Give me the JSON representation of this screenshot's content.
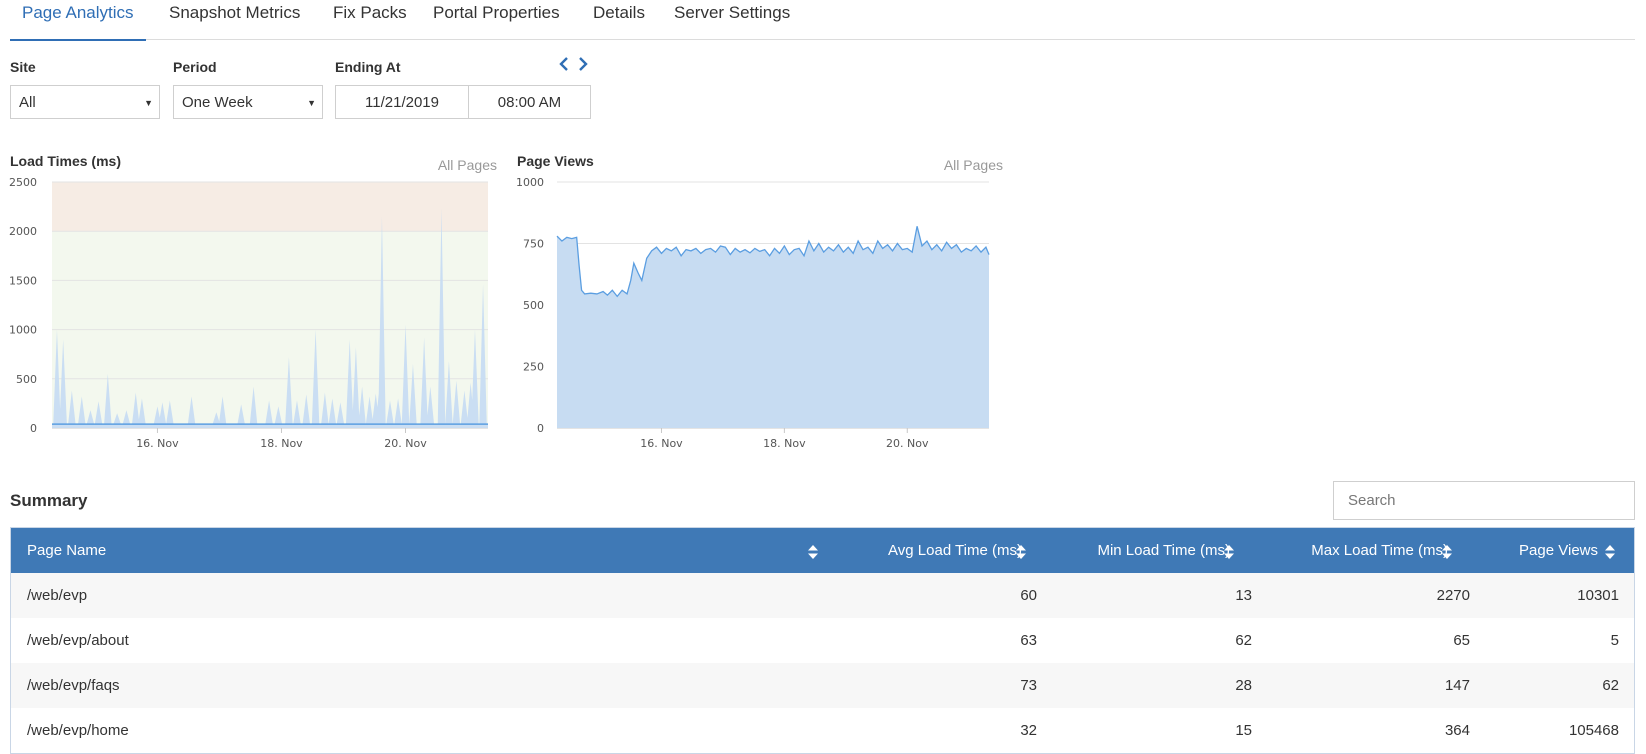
{
  "tabs": [
    {
      "label": "Page Analytics",
      "active": true
    },
    {
      "label": "Snapshot Metrics"
    },
    {
      "label": "Fix Packs"
    },
    {
      "label": "Portal Properties"
    },
    {
      "label": "Details"
    },
    {
      "label": "Server Settings"
    }
  ],
  "filters": {
    "site": {
      "label": "Site",
      "value": "All"
    },
    "period": {
      "label": "Period",
      "value": "One Week"
    },
    "ending": {
      "label": "Ending At",
      "date": "11/21/2019",
      "time": "08:00 AM"
    }
  },
  "colors": {
    "accent": "#2f6eb5",
    "table_header": "#3f79b6",
    "series_line": "#5b9ee1",
    "series_fill": "#c7dcf2",
    "band_warning": "#f6ece4",
    "band_ok": "#f3f8ee"
  },
  "icons": {
    "prev": "chevron-left-icon",
    "next": "chevron-right-icon",
    "sort": "sort-icon",
    "caret": "caret-down-icon"
  },
  "chart_data": [
    {
      "type": "area",
      "title": "Load Times (ms)",
      "subtitle": "All Pages",
      "ylim": [
        0,
        2500
      ],
      "yticks": [
        "0",
        "500",
        "1000",
        "1500",
        "2000",
        "2500"
      ],
      "xlim_days": [
        14.3,
        21.33
      ],
      "xticks": [
        {
          "day": 16,
          "label": "16. Nov"
        },
        {
          "day": 18,
          "label": "18. Nov"
        },
        {
          "day": 20,
          "label": "20. Nov"
        }
      ],
      "bands": [
        {
          "from": 0,
          "to": 2000,
          "tone": "ok"
        },
        {
          "from": 2000,
          "to": 2500,
          "tone": "warning"
        }
      ],
      "grid": true,
      "spikes": [
        {
          "day": 14.38,
          "ms": 1000
        },
        {
          "day": 14.48,
          "ms": 900
        },
        {
          "day": 14.62,
          "ms": 380
        },
        {
          "day": 14.78,
          "ms": 320
        },
        {
          "day": 14.92,
          "ms": 180
        },
        {
          "day": 15.05,
          "ms": 270
        },
        {
          "day": 15.2,
          "ms": 550
        },
        {
          "day": 15.35,
          "ms": 150
        },
        {
          "day": 15.5,
          "ms": 180
        },
        {
          "day": 15.65,
          "ms": 360
        },
        {
          "day": 15.75,
          "ms": 300
        },
        {
          "day": 16.0,
          "ms": 220
        },
        {
          "day": 16.08,
          "ms": 260
        },
        {
          "day": 16.2,
          "ms": 280
        },
        {
          "day": 16.55,
          "ms": 320
        },
        {
          "day": 16.95,
          "ms": 160
        },
        {
          "day": 17.05,
          "ms": 320
        },
        {
          "day": 17.35,
          "ms": 240
        },
        {
          "day": 17.55,
          "ms": 420
        },
        {
          "day": 17.8,
          "ms": 280
        },
        {
          "day": 17.95,
          "ms": 220
        },
        {
          "day": 18.12,
          "ms": 720
        },
        {
          "day": 18.25,
          "ms": 280
        },
        {
          "day": 18.4,
          "ms": 340
        },
        {
          "day": 18.55,
          "ms": 1000
        },
        {
          "day": 18.7,
          "ms": 360
        },
        {
          "day": 18.82,
          "ms": 300
        },
        {
          "day": 18.95,
          "ms": 260
        },
        {
          "day": 19.1,
          "ms": 900
        },
        {
          "day": 19.2,
          "ms": 820
        },
        {
          "day": 19.3,
          "ms": 420
        },
        {
          "day": 19.42,
          "ms": 320
        },
        {
          "day": 19.52,
          "ms": 350
        },
        {
          "day": 19.58,
          "ms": 420
        },
        {
          "day": 19.62,
          "ms": 2150
        },
        {
          "day": 19.75,
          "ms": 280
        },
        {
          "day": 19.88,
          "ms": 300
        },
        {
          "day": 20.0,
          "ms": 1050
        },
        {
          "day": 20.12,
          "ms": 650
        },
        {
          "day": 20.3,
          "ms": 920
        },
        {
          "day": 20.4,
          "ms": 420
        },
        {
          "day": 20.58,
          "ms": 2230
        },
        {
          "day": 20.7,
          "ms": 680
        },
        {
          "day": 20.82,
          "ms": 480
        },
        {
          "day": 20.95,
          "ms": 380
        },
        {
          "day": 21.05,
          "ms": 460
        },
        {
          "day": 21.12,
          "ms": 1000
        },
        {
          "day": 21.25,
          "ms": 1460
        }
      ],
      "baseline_ms": 40,
      "peak_ms": 2270
    },
    {
      "type": "area",
      "title": "Page Views",
      "subtitle": "All Pages",
      "ylim": [
        0,
        1000
      ],
      "yticks": [
        "0",
        "250",
        "500",
        "750",
        "1000"
      ],
      "xlim_days": [
        14.3,
        21.33
      ],
      "xticks": [
        {
          "day": 16,
          "label": "16. Nov"
        },
        {
          "day": 18,
          "label": "18. Nov"
        },
        {
          "day": 20,
          "label": "20. Nov"
        }
      ],
      "grid": true,
      "points": [
        [
          14.3,
          780
        ],
        [
          14.38,
          760
        ],
        [
          14.46,
          775
        ],
        [
          14.54,
          770
        ],
        [
          14.62,
          775
        ],
        [
          14.66,
          660
        ],
        [
          14.7,
          560
        ],
        [
          14.75,
          545
        ],
        [
          14.85,
          548
        ],
        [
          14.95,
          545
        ],
        [
          15.05,
          555
        ],
        [
          15.12,
          540
        ],
        [
          15.2,
          560
        ],
        [
          15.28,
          535
        ],
        [
          15.36,
          560
        ],
        [
          15.44,
          545
        ],
        [
          15.5,
          600
        ],
        [
          15.55,
          670
        ],
        [
          15.62,
          630
        ],
        [
          15.68,
          600
        ],
        [
          15.76,
          690
        ],
        [
          15.84,
          720
        ],
        [
          15.92,
          735
        ],
        [
          16.0,
          710
        ],
        [
          16.08,
          730
        ],
        [
          16.16,
          720
        ],
        [
          16.24,
          735
        ],
        [
          16.32,
          700
        ],
        [
          16.4,
          725
        ],
        [
          16.48,
          720
        ],
        [
          16.56,
          730
        ],
        [
          16.64,
          710
        ],
        [
          16.72,
          725
        ],
        [
          16.8,
          730
        ],
        [
          16.88,
          715
        ],
        [
          16.96,
          740
        ],
        [
          17.04,
          735
        ],
        [
          17.12,
          705
        ],
        [
          17.2,
          730
        ],
        [
          17.28,
          715
        ],
        [
          17.36,
          725
        ],
        [
          17.44,
          712
        ],
        [
          17.52,
          730
        ],
        [
          17.6,
          718
        ],
        [
          17.68,
          725
        ],
        [
          17.76,
          700
        ],
        [
          17.84,
          730
        ],
        [
          17.92,
          710
        ],
        [
          18.0,
          740
        ],
        [
          18.08,
          705
        ],
        [
          18.16,
          725
        ],
        [
          18.24,
          730
        ],
        [
          18.32,
          700
        ],
        [
          18.4,
          760
        ],
        [
          18.48,
          720
        ],
        [
          18.56,
          750
        ],
        [
          18.64,
          715
        ],
        [
          18.72,
          735
        ],
        [
          18.8,
          720
        ],
        [
          18.88,
          745
        ],
        [
          18.96,
          715
        ],
        [
          19.04,
          735
        ],
        [
          19.12,
          710
        ],
        [
          19.2,
          760
        ],
        [
          19.28,
          725
        ],
        [
          19.36,
          735
        ],
        [
          19.44,
          710
        ],
        [
          19.52,
          760
        ],
        [
          19.6,
          730
        ],
        [
          19.68,
          745
        ],
        [
          19.76,
          720
        ],
        [
          19.84,
          750
        ],
        [
          19.92,
          725
        ],
        [
          20.0,
          730
        ],
        [
          20.08,
          715
        ],
        [
          20.16,
          820
        ],
        [
          20.24,
          740
        ],
        [
          20.32,
          760
        ],
        [
          20.4,
          725
        ],
        [
          20.48,
          745
        ],
        [
          20.56,
          720
        ],
        [
          20.64,
          755
        ],
        [
          20.72,
          730
        ],
        [
          20.8,
          745
        ],
        [
          20.88,
          715
        ],
        [
          20.96,
          730
        ],
        [
          21.04,
          720
        ],
        [
          21.12,
          740
        ],
        [
          21.2,
          715
        ],
        [
          21.28,
          735
        ],
        [
          21.33,
          705
        ]
      ]
    }
  ],
  "summary": {
    "title": "Summary",
    "search_placeholder": "Search",
    "columns": [
      "Page Name",
      "Avg Load Time (ms)",
      "Min Load Time (ms)",
      "Max Load Time (ms)",
      "Page Views"
    ],
    "rows": [
      {
        "page": "/web/evp",
        "avg": "60",
        "min": "13",
        "max": "2270",
        "views": "10301"
      },
      {
        "page": "/web/evp/about",
        "avg": "63",
        "min": "62",
        "max": "65",
        "views": "5"
      },
      {
        "page": "/web/evp/faqs",
        "avg": "73",
        "min": "28",
        "max": "147",
        "views": "62"
      },
      {
        "page": "/web/evp/home",
        "avg": "32",
        "min": "15",
        "max": "364",
        "views": "105468"
      }
    ]
  }
}
